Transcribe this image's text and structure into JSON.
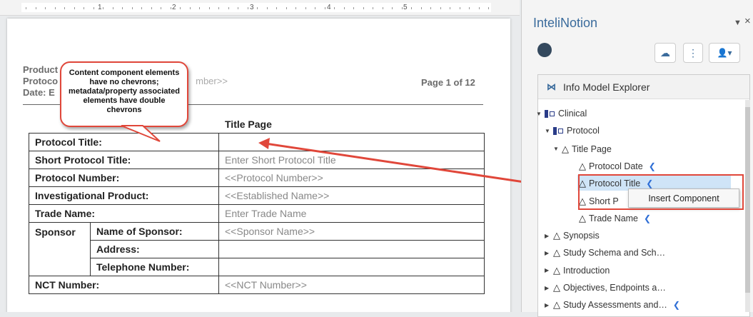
{
  "ruler": {
    "numbers": [
      "1",
      "2",
      "3",
      "4",
      "5"
    ]
  },
  "document": {
    "header_lines": [
      "Product",
      "Protoco",
      "Date: E"
    ],
    "header_grey": "mber>>",
    "page_number": "Page 1 of 12",
    "title": "Title Page",
    "rows": [
      {
        "label": "Protocol Title:",
        "value": ""
      },
      {
        "label": "Short Protocol Title:",
        "value": "Enter Short Protocol Title"
      },
      {
        "label": "Protocol Number:",
        "value": "<<Protocol Number>>"
      },
      {
        "label": "Investigational Product:",
        "value": "<<Established Name>>"
      },
      {
        "label": "Trade Name:",
        "value": "Enter Trade Name"
      },
      {
        "label": "Sponsor",
        "sub": "Name of Sponsor:",
        "value": "<<Sponsor Name>>"
      },
      {
        "sub": "Address:",
        "value": ""
      },
      {
        "sub": "Telephone Number:",
        "value": ""
      },
      {
        "label": "NCT Number:",
        "value": "<<NCT Number>>"
      }
    ],
    "callout": "Content component elements have no chevrons; metadata/property associated elements have double chevrons"
  },
  "panel": {
    "title": "InteliNotion",
    "chevron": "▼",
    "close": "×",
    "explorer_title": "Info Model Explorer",
    "tree": [
      {
        "label": "Clinical",
        "kind": "entity",
        "twisty": "▼"
      },
      {
        "label": "Protocol",
        "kind": "entity",
        "twisty": "▼"
      },
      {
        "label": "Title Page",
        "kind": "tri",
        "twisty": "▼"
      },
      {
        "label": "Protocol Date",
        "kind": "tri",
        "twisty": "",
        "feather": true
      },
      {
        "label": "Protocol Title",
        "kind": "tri",
        "twisty": "",
        "feather": true
      },
      {
        "label": "Short P",
        "kind": "tri",
        "twisty": ""
      },
      {
        "label": "Trade Name",
        "kind": "tri",
        "twisty": "",
        "feather": true
      },
      {
        "label": "Synopsis",
        "kind": "tri",
        "twisty": "▶"
      },
      {
        "label": "Study Schema and Sch…",
        "kind": "tri",
        "twisty": "▶"
      },
      {
        "label": "Introduction",
        "kind": "tri",
        "twisty": "▶"
      },
      {
        "label": "Objectives, Endpoints a…",
        "kind": "tri",
        "twisty": "▶"
      },
      {
        "label": "Study Assessments and…",
        "kind": "tri",
        "twisty": "▶",
        "feather": true
      }
    ],
    "context_menu": "Insert Component",
    "buttons": {
      "upload": "☁",
      "more": "⋮",
      "user": "👤▾"
    }
  },
  "colors": {
    "accent": "#3a6b9c",
    "highlight": "#e0473a",
    "selection": "#cfe4f7"
  }
}
